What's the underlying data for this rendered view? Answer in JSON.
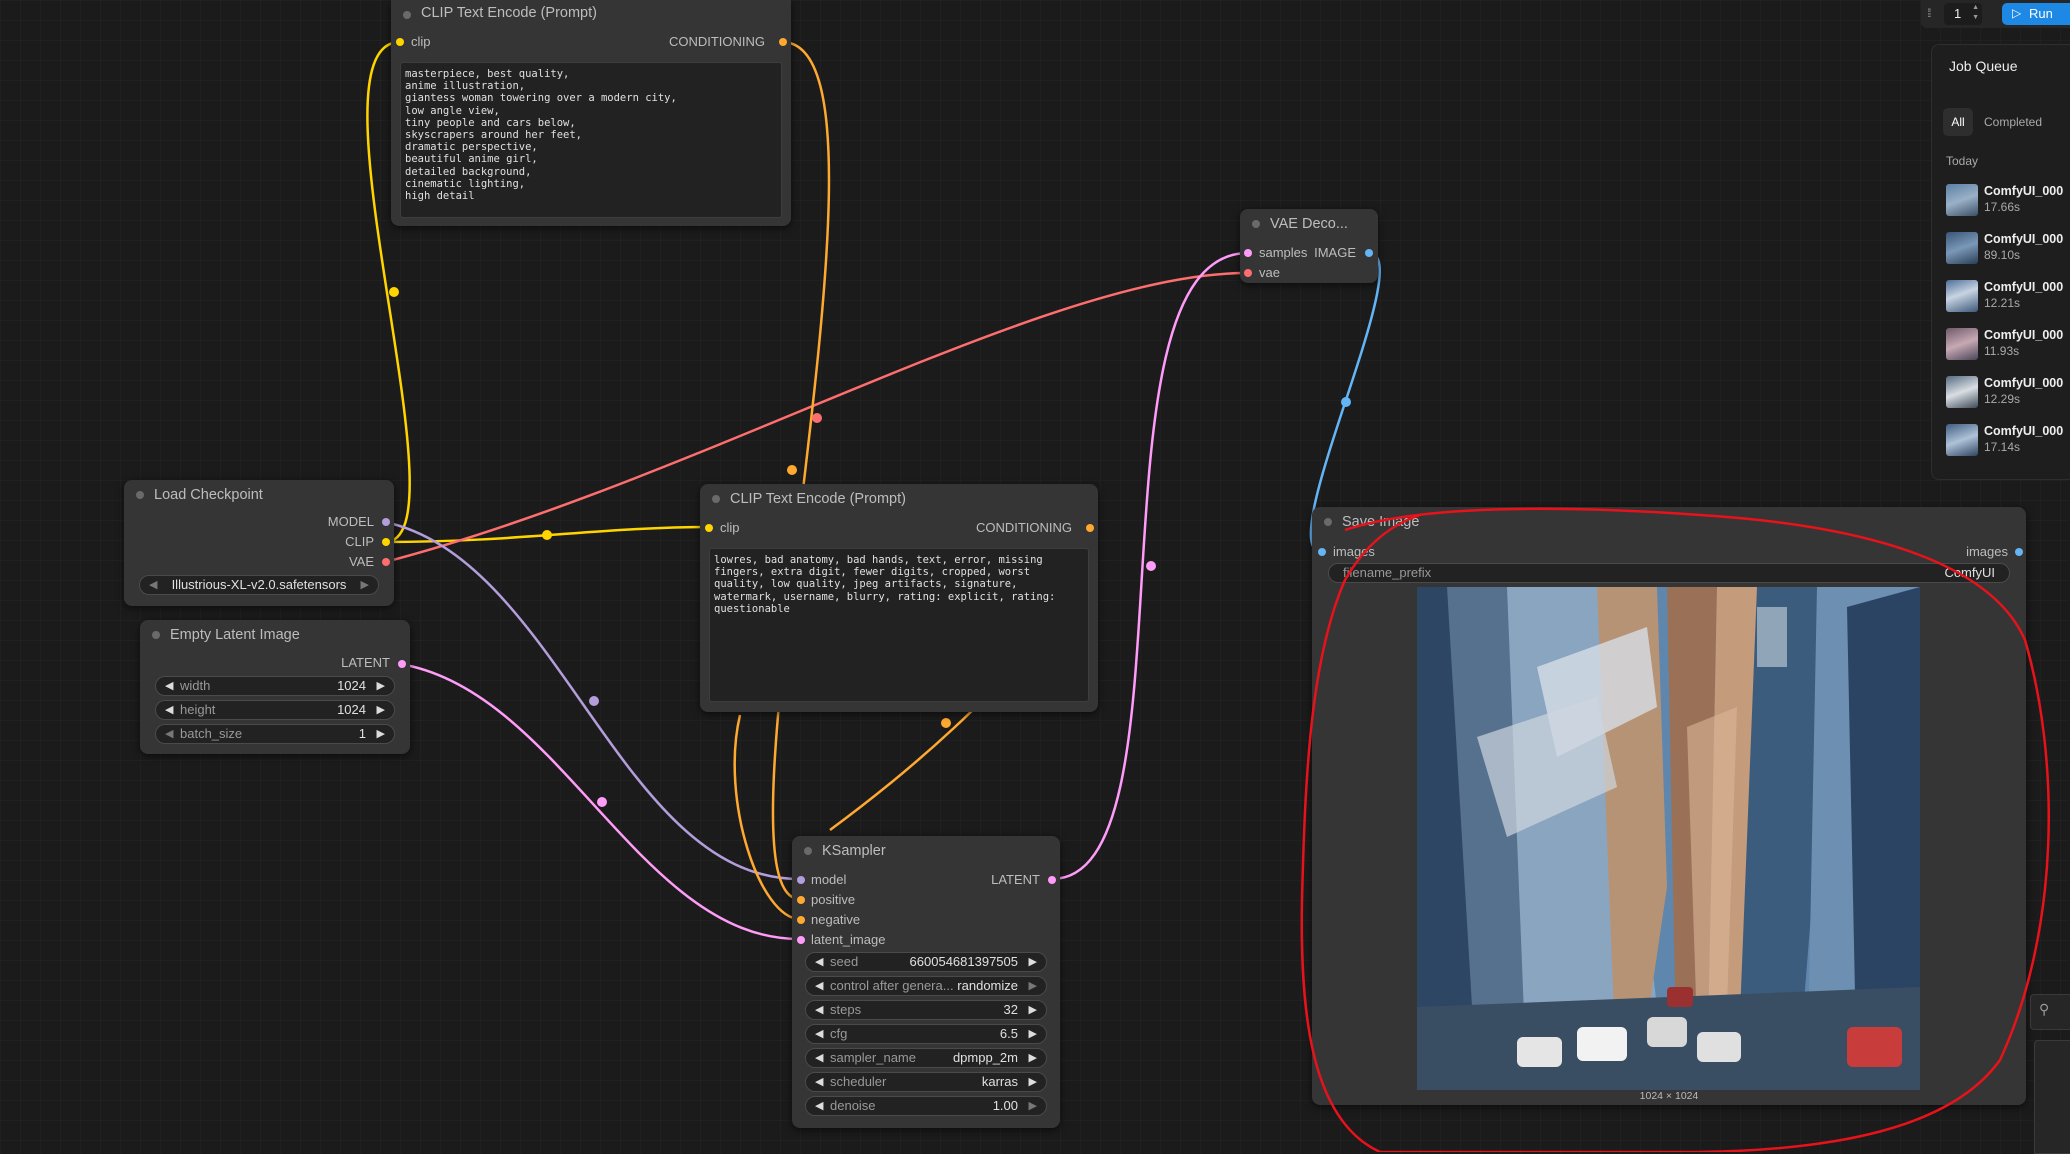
{
  "nodes": {
    "clip_top": {
      "title": "CLIP Text Encode (Prompt)",
      "input": "clip",
      "output": "CONDITIONING",
      "text": "masterpiece, best quality,\nanime illustration,\ngiantess woman towering over a modern city,\nlow angle view,\ntiny people and cars below,\nskyscrapers around her feet,\ndramatic perspective,\nbeautiful anime girl,\ndetailed background,\ncinematic lighting,\nhigh detail"
    },
    "clip_neg": {
      "title": "CLIP Text Encode (Prompt)",
      "input": "clip",
      "output": "CONDITIONING",
      "text": "lowres, bad anatomy, bad hands, text, error, missing fingers, extra digit, fewer digits, cropped, worst quality, low quality, jpeg artifacts, signature, watermark, username, blurry, rating: explicit, rating: questionable"
    },
    "checkpoint": {
      "title": "Load Checkpoint",
      "outputs": [
        "MODEL",
        "CLIP",
        "VAE"
      ],
      "ckpt_name": "Illustrious-XL-v2.0.safetensors"
    },
    "latent": {
      "title": "Empty Latent Image",
      "output": "LATENT",
      "width_label": "width",
      "width": "1024",
      "height_label": "height",
      "height": "1024",
      "batch_label": "batch_size",
      "batch": "1"
    },
    "vae": {
      "title": "VAE Deco...",
      "inputs": [
        "samples",
        "vae"
      ],
      "output": "IMAGE"
    },
    "save": {
      "title": "Save Image",
      "input": "images",
      "output": "images",
      "prefix_label": "filename_prefix",
      "prefix": "ComfyUI",
      "dimensions": "1024 × 1024"
    },
    "ksampler": {
      "title": "KSampler",
      "inputs": [
        "model",
        "positive",
        "negative",
        "latent_image"
      ],
      "output": "LATENT",
      "widgets": [
        {
          "label": "seed",
          "value": "660054681397505"
        },
        {
          "label": "control after genera...",
          "value": "randomize"
        },
        {
          "label": "steps",
          "value": "32"
        },
        {
          "label": "cfg",
          "value": "6.5"
        },
        {
          "label": "sampler_name",
          "value": "dpmpp_2m"
        },
        {
          "label": "scheduler",
          "value": "karras"
        },
        {
          "label": "denoise",
          "value": "1.00"
        }
      ]
    }
  },
  "topbar": {
    "batch_count": "1",
    "run_label": "Run"
  },
  "queue": {
    "title": "Job Queue",
    "tabs": [
      "All",
      "Completed"
    ],
    "section": "Today",
    "items": [
      {
        "name": "ComfyUI_000",
        "time": "17.66s"
      },
      {
        "name": "ComfyUI_000",
        "time": "89.10s"
      },
      {
        "name": "ComfyUI_000",
        "time": "12.21s"
      },
      {
        "name": "ComfyUI_000",
        "time": "11.93s"
      },
      {
        "name": "ComfyUI_000",
        "time": "12.29s"
      },
      {
        "name": "ComfyUI_000",
        "time": "17.14s"
      }
    ]
  },
  "colors": {
    "canvas": "#1b1b1b",
    "node": "#353535",
    "clip_wire": "#ffd500",
    "conditioning_wire": "#ffa931",
    "model_wire": "#b39ddb",
    "latent_wire": "#ff9cf9",
    "vae_wire": "#ff6e6e",
    "image_wire": "#64b5f6",
    "annotation": "#e8121b",
    "run_button": "#1e88e5"
  }
}
